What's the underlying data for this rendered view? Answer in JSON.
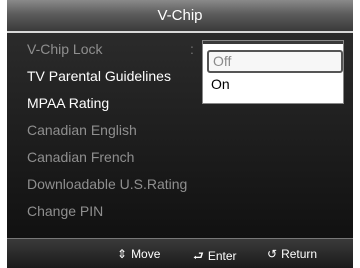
{
  "window": {
    "title": "V-Chip"
  },
  "menu": {
    "items": [
      {
        "label": "V-Chip Lock",
        "state": "dim"
      },
      {
        "label": "TV Parental Guidelines",
        "state": "active"
      },
      {
        "label": "MPAA Rating",
        "state": "active"
      },
      {
        "label": "Canadian English",
        "state": "dim"
      },
      {
        "label": "Canadian French",
        "state": "dim"
      },
      {
        "label": "Downloadable U.S.Rating",
        "state": "dim"
      },
      {
        "label": "Change PIN",
        "state": "dim"
      }
    ],
    "separator": ":"
  },
  "dropdown": {
    "options": [
      {
        "label": "Off",
        "selected": true
      },
      {
        "label": "On",
        "selected": false
      }
    ]
  },
  "footer": {
    "move": {
      "icon": "updown-arrow-icon",
      "glyph": "⇕",
      "label": "Move"
    },
    "enter": {
      "icon": "enter-icon",
      "glyph": "⮐",
      "label": "Enter"
    },
    "return": {
      "icon": "return-icon",
      "glyph": "↺",
      "label": "Return"
    }
  }
}
